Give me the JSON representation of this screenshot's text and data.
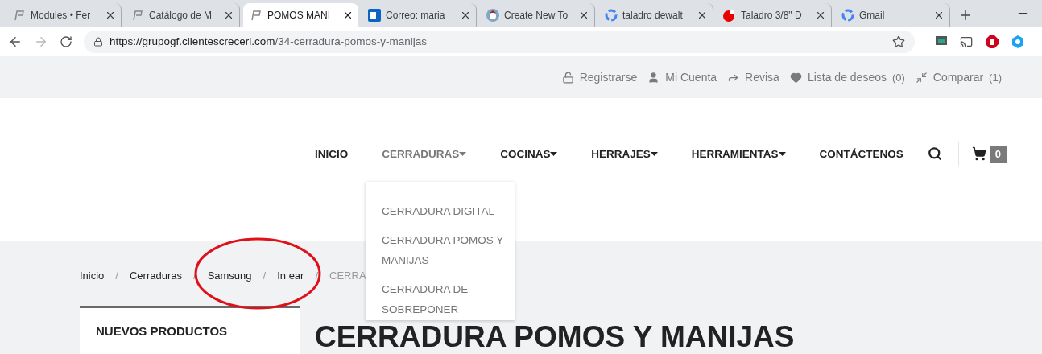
{
  "browser": {
    "tabs": [
      {
        "title": "Modules • Fer",
        "selected": false
      },
      {
        "title": "Catálogo de M",
        "selected": false
      },
      {
        "title": "POMOS MANI",
        "selected": true
      },
      {
        "title": "Correo: maria",
        "selected": false
      },
      {
        "title": "Create New To",
        "selected": false
      },
      {
        "title": "taladro dewalt",
        "selected": false
      },
      {
        "title": "Taladro 3/8\" D",
        "selected": false
      },
      {
        "title": "Gmail",
        "selected": false
      }
    ],
    "url_host": "https://grupogf.clientescreceri.com",
    "url_path": "/34-cerradura-pomos-y-manijas"
  },
  "top_links": [
    {
      "label": "Registrarse"
    },
    {
      "label": "Mi Cuenta"
    },
    {
      "label": "Revisa"
    },
    {
      "label": "Lista de deseos",
      "count": "(0)"
    },
    {
      "label": "Comparar",
      "count": "(1)"
    }
  ],
  "nav": {
    "items": [
      {
        "label": "INICIO",
        "has_menu": false,
        "selected": false
      },
      {
        "label": "CERRADURAS",
        "has_menu": true,
        "selected": true
      },
      {
        "label": "COCINAS",
        "has_menu": true,
        "selected": false
      },
      {
        "label": "HERRAJES",
        "has_menu": true,
        "selected": false
      },
      {
        "label": "HERRAMIENTAS",
        "has_menu": true,
        "selected": false
      },
      {
        "label": "CONTÁCTENOS",
        "has_menu": false,
        "selected": false
      }
    ],
    "cart_count": "0",
    "dropdown": [
      "CERRADURA DIGITAL",
      "CERRADURA POMOS Y MANIJAS",
      "CERRADURA DE SOBREPONER"
    ]
  },
  "breadcrumb": [
    {
      "label": "Inicio",
      "separator": "/"
    },
    {
      "label": "Cerraduras",
      "separator": "/"
    },
    {
      "label": "Samsung",
      "separator": "/"
    },
    {
      "label": "In ear",
      "separator": "/"
    },
    {
      "label": "CERRA"
    }
  ],
  "sidebar": {
    "title": "NUEVOS PRODUCTOS"
  },
  "page_title": "CERRADURA POMOS Y MANIJAS"
}
